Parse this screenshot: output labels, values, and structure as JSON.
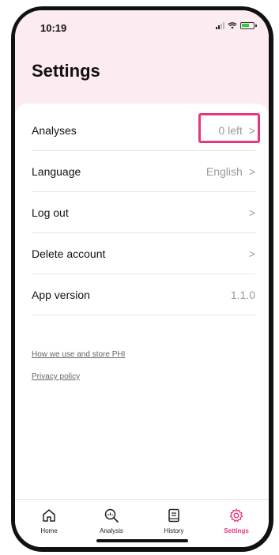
{
  "status_bar": {
    "time": "10:19"
  },
  "header": {
    "title": "Settings"
  },
  "settings": {
    "rows": [
      {
        "label": "Analyses",
        "value": "0 left"
      },
      {
        "label": "Language",
        "value": "English"
      },
      {
        "label": "Log out",
        "value": ""
      },
      {
        "label": "Delete account",
        "value": ""
      },
      {
        "label": "App version",
        "value": "1.1.0"
      }
    ]
  },
  "links": {
    "phi": "How we use and store PHI",
    "privacy": "Privacy policy"
  },
  "tabbar": {
    "tabs": [
      {
        "label": "Home",
        "icon": "home-icon"
      },
      {
        "label": "Analysis",
        "icon": "analysis-search-icon"
      },
      {
        "label": "History",
        "icon": "history-document-icon"
      },
      {
        "label": "Settings",
        "icon": "settings-gear-icon"
      }
    ],
    "active_tab": "Settings"
  },
  "colors": {
    "accent": "#e8357c",
    "header_bg": "#fcebf1"
  }
}
